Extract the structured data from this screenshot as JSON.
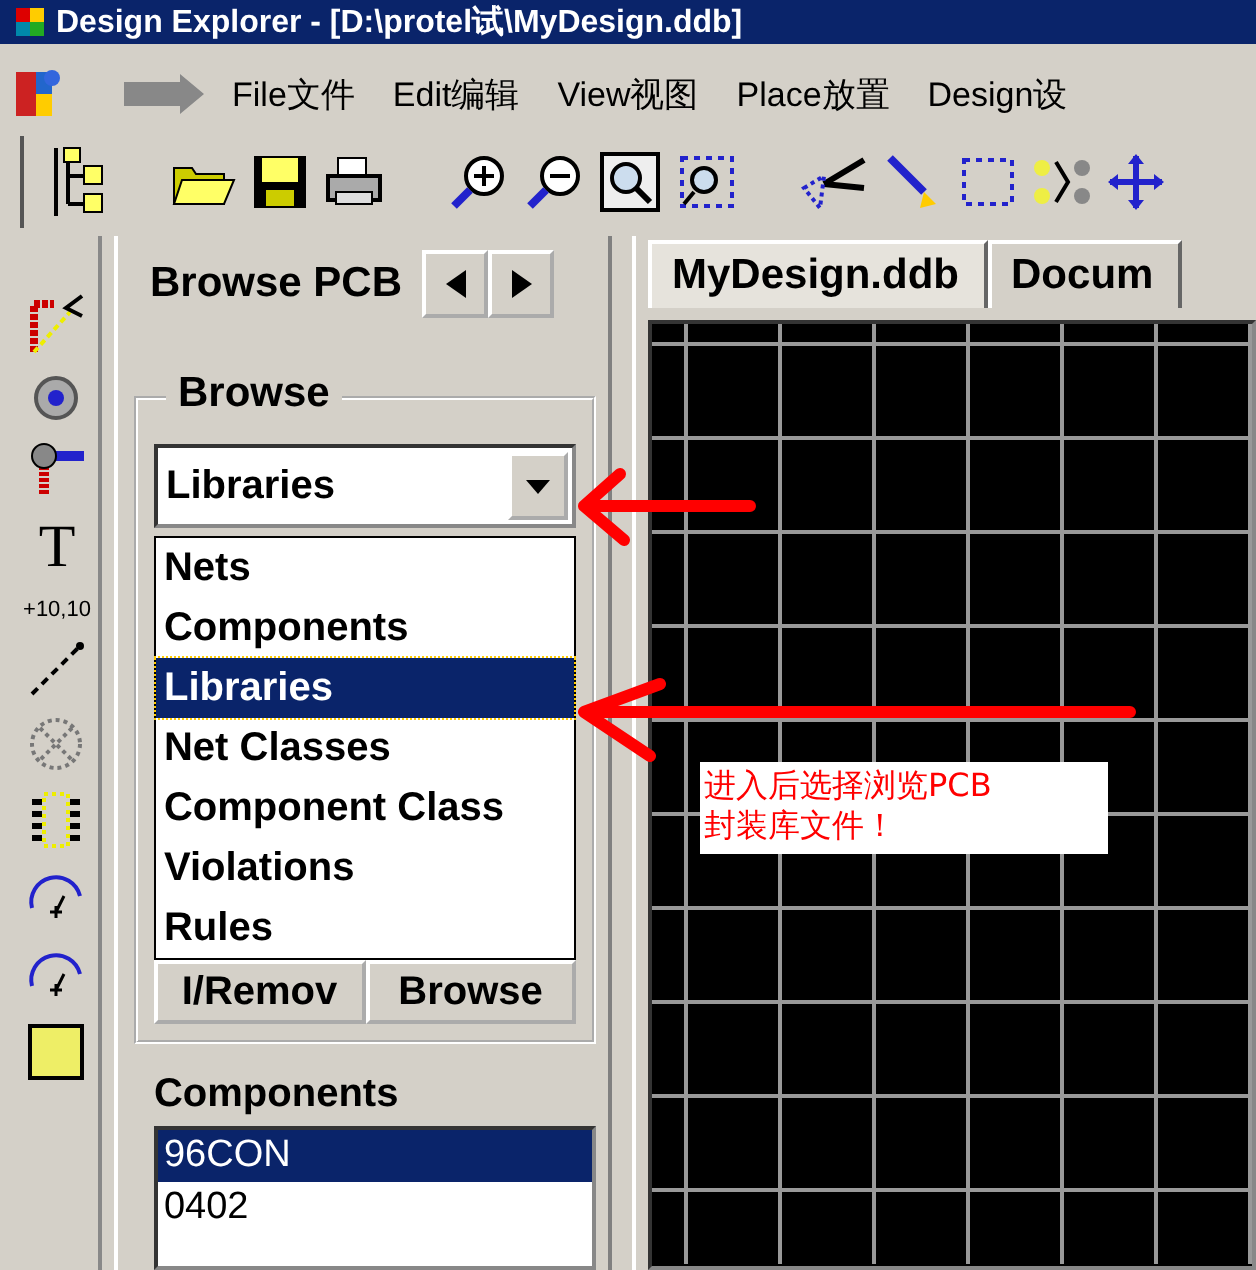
{
  "title_bar": {
    "title": "Design Explorer - [D:\\protel试\\MyDesign.ddb]"
  },
  "menu": [
    {
      "label": "File文件"
    },
    {
      "label": "Edit编辑"
    },
    {
      "label": "View视图"
    },
    {
      "label": "Place放置"
    },
    {
      "label": "Design设"
    }
  ],
  "left_tools": [
    {
      "kind": "route"
    },
    {
      "kind": "pad"
    },
    {
      "kind": "via"
    },
    {
      "kind": "glyph",
      "text": "T"
    },
    {
      "kind": "glyph",
      "text": "+10,10"
    },
    {
      "kind": "dimension"
    },
    {
      "kind": "keepout"
    },
    {
      "kind": "component"
    },
    {
      "kind": "arc"
    },
    {
      "kind": "arc"
    },
    {
      "kind": "fill"
    }
  ],
  "panel": {
    "tab": "Browse PCB",
    "group_title": "Browse",
    "combo": {
      "value": "Libraries"
    },
    "dropdown": [
      {
        "label": "Nets",
        "selected": false
      },
      {
        "label": "Components",
        "selected": false
      },
      {
        "label": "Libraries",
        "selected": true
      },
      {
        "label": "Net Classes",
        "selected": false
      },
      {
        "label": "Component Class",
        "selected": false
      },
      {
        "label": "Violations",
        "selected": false
      },
      {
        "label": "Rules",
        "selected": false
      }
    ],
    "buttons": [
      "I/Remov",
      "Browse"
    ],
    "list_title": "Components",
    "components": [
      {
        "label": "96CON",
        "selected": true
      },
      {
        "label": "0402",
        "selected": false
      }
    ]
  },
  "documents": {
    "tabs": [
      {
        "label": "MyDesign.ddb",
        "selected": true
      },
      {
        "label": "Docum",
        "selected": false
      }
    ]
  },
  "annotation": {
    "text": "进入后选择浏览PCB封装库文件！"
  }
}
